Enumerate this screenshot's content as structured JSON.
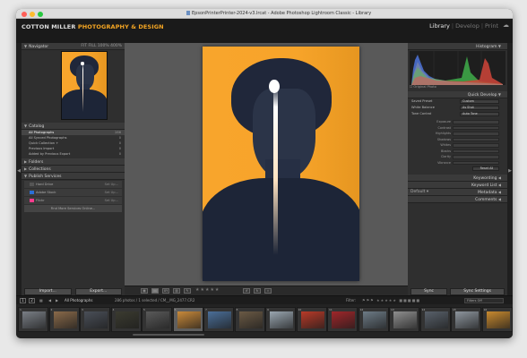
{
  "window": {
    "title": "EpsonPrinterPrinter-2024-v3.lrcat - Adobe Photoshop Lightroom Classic - Library"
  },
  "identity": {
    "name": "COTTON MILLER ",
    "accent": "PHOTOGRAPHY & DESIGN",
    "accent_color": "#f5a623"
  },
  "modules": {
    "items": [
      "Library",
      "Develop",
      "Print"
    ],
    "active": "Library"
  },
  "left": {
    "navigator": {
      "title": "Navigator",
      "zoom": [
        "FIT",
        "FILL",
        "100%",
        "400%"
      ]
    },
    "catalog": {
      "title": "Catalog",
      "items": [
        {
          "label": "All Photographs",
          "count": "286"
        },
        {
          "label": "All Synced Photographs",
          "count": "0"
        },
        {
          "label": "Quick Collection +",
          "count": "0"
        },
        {
          "label": "Previous Import",
          "count": "0"
        },
        {
          "label": "Added by Previous Export",
          "count": "0"
        }
      ]
    },
    "sections": {
      "folders": "Folders",
      "collections": "Collections",
      "publish": "Publish Services"
    },
    "services": [
      {
        "label": "Hard Drive",
        "action": "Set Up...",
        "color": "#555555"
      },
      {
        "label": "Adobe Stock",
        "action": "Set Up...",
        "color": "#2b6fd6"
      },
      {
        "label": "Flickr",
        "action": "Set Up...",
        "color": "#ff3c8e"
      }
    ],
    "find_more": "Find More Services Online...",
    "import_label": "Import...",
    "export_label": "Export..."
  },
  "right": {
    "histogram": {
      "title": "Histogram",
      "original_photo": "Original Photo"
    },
    "quick_develop": {
      "title": "Quick Develop",
      "saved_preset": {
        "label": "Saved Preset",
        "value": "Custom"
      },
      "white_balance": {
        "label": "White Balance",
        "value": "As Shot"
      },
      "tone_control": {
        "label": "Tone Control",
        "value": "Auto Tone"
      },
      "controls": [
        "Exposure",
        "Contrast",
        "Highlights",
        "Shadows",
        "Whites",
        "Blacks",
        "Clarity",
        "Vibrance"
      ],
      "reset": "Reset All"
    },
    "keywording": "Keywording",
    "keyword_list": "Keyword List",
    "metadata": {
      "title": "Metadata",
      "preset": "Default"
    },
    "comments": "Comments",
    "sync_label": "Sync",
    "sync_settings_label": "Sync Settings"
  },
  "toolbar": {
    "rating_stars": "★★★★★"
  },
  "filmstrip_bar": {
    "page1": "1",
    "page2": "2",
    "source": "All Photographs",
    "info": "286 photos / 1 selected / CM__MG_2477.CR2",
    "filter_label": "Filter:",
    "filters_off": "Filters Off"
  },
  "filmstrip": {
    "cells": [
      {
        "num": "1",
        "tone": "#7a7f86"
      },
      {
        "num": "2",
        "tone": "#8a6a4a"
      },
      {
        "num": "3",
        "tone": "#4a4f58"
      },
      {
        "num": "4",
        "tone": "#3b3b30"
      },
      {
        "num": "5",
        "tone": "#5a5a5a"
      },
      {
        "num": "6",
        "tone": "#c98a3a"
      },
      {
        "num": "7",
        "tone": "#4b6f99"
      },
      {
        "num": "8",
        "tone": "#6b5a45"
      },
      {
        "num": "9",
        "tone": "#9aa6b0"
      },
      {
        "num": "10",
        "tone": "#b83a28"
      },
      {
        "num": "11",
        "tone": "#a0262a"
      },
      {
        "num": "12",
        "tone": "#6d7b86"
      },
      {
        "num": "13",
        "tone": "#8f8f8f"
      },
      {
        "num": "14",
        "tone": "#59616b"
      },
      {
        "num": "15",
        "tone": "#8e969e"
      },
      {
        "num": "16",
        "tone": "#c88a2f"
      }
    ],
    "selected_index": 5
  }
}
